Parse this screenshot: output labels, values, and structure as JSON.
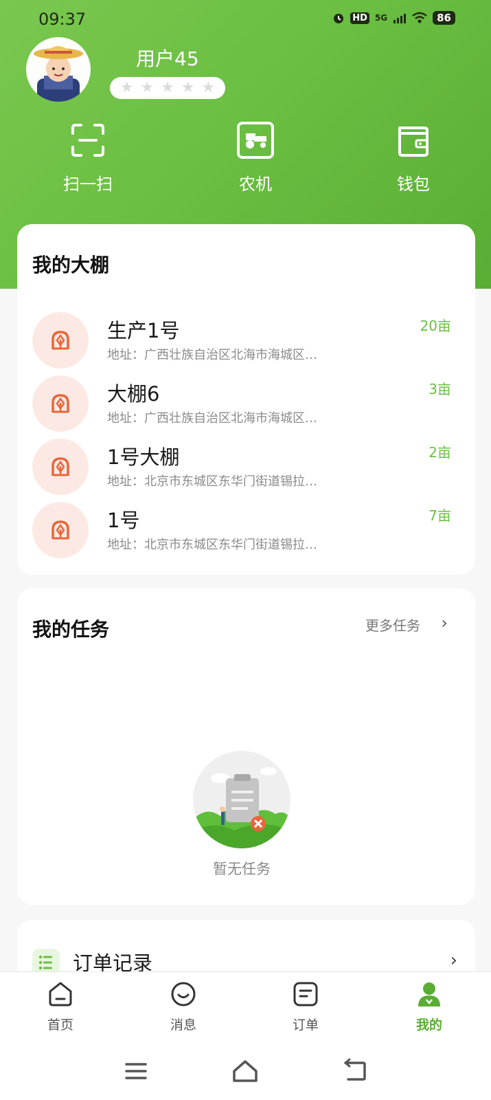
{
  "status_bar": {
    "time": "09:37",
    "hd": "HD",
    "network": "5G",
    "battery": "86"
  },
  "profile": {
    "username": "用户45",
    "rating_stars": 0,
    "rating_max": 5
  },
  "quick_actions": [
    {
      "label": "扫一扫",
      "icon": "scan-icon"
    },
    {
      "label": "农机",
      "icon": "tractor-icon"
    },
    {
      "label": "钱包",
      "icon": "wallet-icon"
    }
  ],
  "greenhouses": {
    "title": "我的大棚",
    "items": [
      {
        "name": "生产1号",
        "address": "地址：广西壮族自治区北海市海城区…",
        "area": "20亩"
      },
      {
        "name": "大棚6",
        "address": "地址：广西壮族自治区北海市海城区…",
        "area": "3亩"
      },
      {
        "name": "1号大棚",
        "address": "地址：北京市东城区东华门街道锡拉…",
        "area": "2亩"
      },
      {
        "name": "1号",
        "address": "地址：北京市东城区东华门街道锡拉…",
        "area": "7亩"
      }
    ]
  },
  "tasks": {
    "title": "我的任务",
    "more_label": "更多任务",
    "empty_text": "暂无任务"
  },
  "orders": {
    "label": "订单记录"
  },
  "tabbar": {
    "active": "我的",
    "items": [
      {
        "label": "首页",
        "icon": "home-icon"
      },
      {
        "label": "消息",
        "icon": "message-icon"
      },
      {
        "label": "订单",
        "icon": "order-icon"
      },
      {
        "label": "我的",
        "icon": "profile-icon"
      }
    ]
  },
  "colors": {
    "brand": "#6bbf42",
    "accent_orange": "#e8663a",
    "icon_bg": "#fde9e3"
  }
}
